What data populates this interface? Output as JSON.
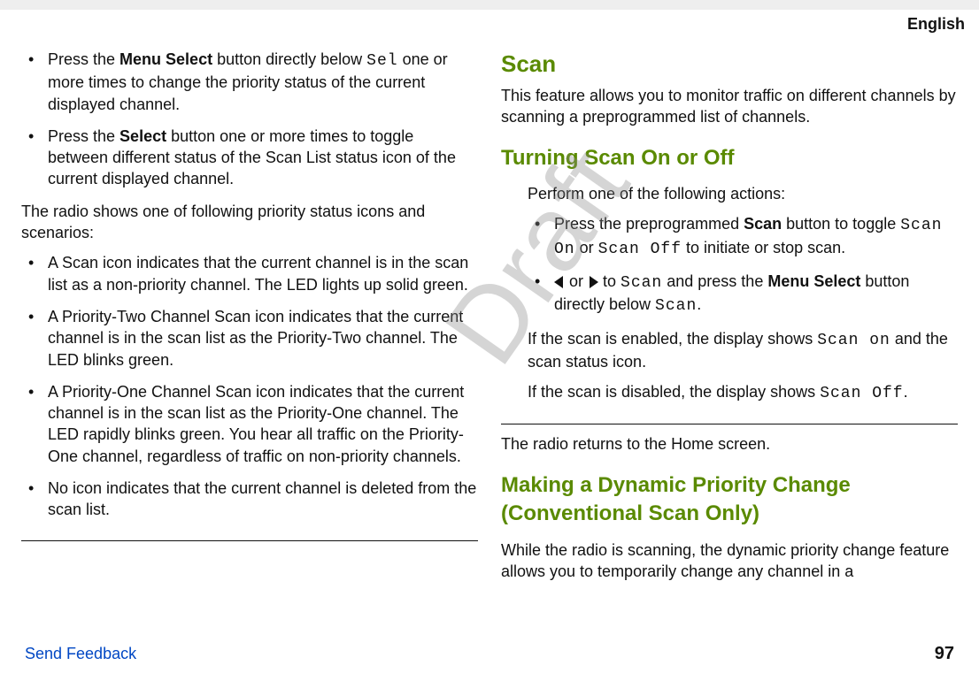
{
  "header": {
    "language": "English"
  },
  "watermark": "Draft",
  "left": {
    "bullets_top": [
      {
        "pre": "Press the ",
        "bold": "Menu Select",
        "mid": " button directly below ",
        "mono": "Sel",
        "post": " one or more times to change the priority status of the current displayed channel."
      },
      {
        "pre": "Press the ",
        "bold": "Select",
        "post2": " button one or more times to toggle between different status of the Scan List status icon of the current displayed channel."
      }
    ],
    "p_intro": "The radio shows one of following priority status icons and scenarios:",
    "bullets_bottom": [
      "A Scan icon indicates that the current channel is in the scan list as a non-priority channel. The LED lights up solid green.",
      "A Priority-Two Channel Scan icon indicates that the current channel is in the scan list as the Priority-Two channel. The LED blinks green.",
      "A Priority-One Channel Scan icon indicates that the current channel is in the scan list as the Priority-One channel. The LED rapidly blinks green. You hear all traffic on the Priority- One channel, regardless of traffic on non-priority channels.",
      "No icon indicates that the current channel is deleted from the scan list."
    ]
  },
  "right": {
    "h_scan": "Scan",
    "p_scan": "This feature allows you to monitor traffic on different channels by scanning a preprogrammed list of channels.",
    "h_turning": "Turning Scan On or Off",
    "p_perform": "Perform one of the following actions:",
    "b1_pre": "Press the preprogrammed ",
    "b1_bold": "Scan",
    "b1_mid": " button to toggle ",
    "b1_mono1": "Scan On",
    "b1_or": " or ",
    "b1_mono2": "Scan Off",
    "b1_post": " to initiate or stop scan.",
    "b2_mid1": " or ",
    "b2_mid2": " to ",
    "b2_mono_scan": "Scan",
    "b2_mid3": " and press the ",
    "b2_bold": "Menu Select",
    "b2_mid4": " button directly below ",
    "b2_mono_scan2": "Scan",
    "b2_end": ".",
    "p_enabled_pre": "If the scan is enabled, the display shows ",
    "p_enabled_mono": "Scan on",
    "p_enabled_post": " and the scan status icon.",
    "p_disabled_pre": "If the scan is disabled, the display shows ",
    "p_disabled_mono": "Scan Off",
    "p_disabled_post": ".",
    "p_returns": "The radio returns to the Home screen.",
    "h_dynamic": "Making a Dynamic Priority Change (Conventional Scan Only)",
    "p_dynamic": "While the radio is scanning, the dynamic priority change feature allows you to temporarily change any channel in a"
  },
  "footer": {
    "send_feedback": "Send Feedback",
    "page": "97"
  }
}
